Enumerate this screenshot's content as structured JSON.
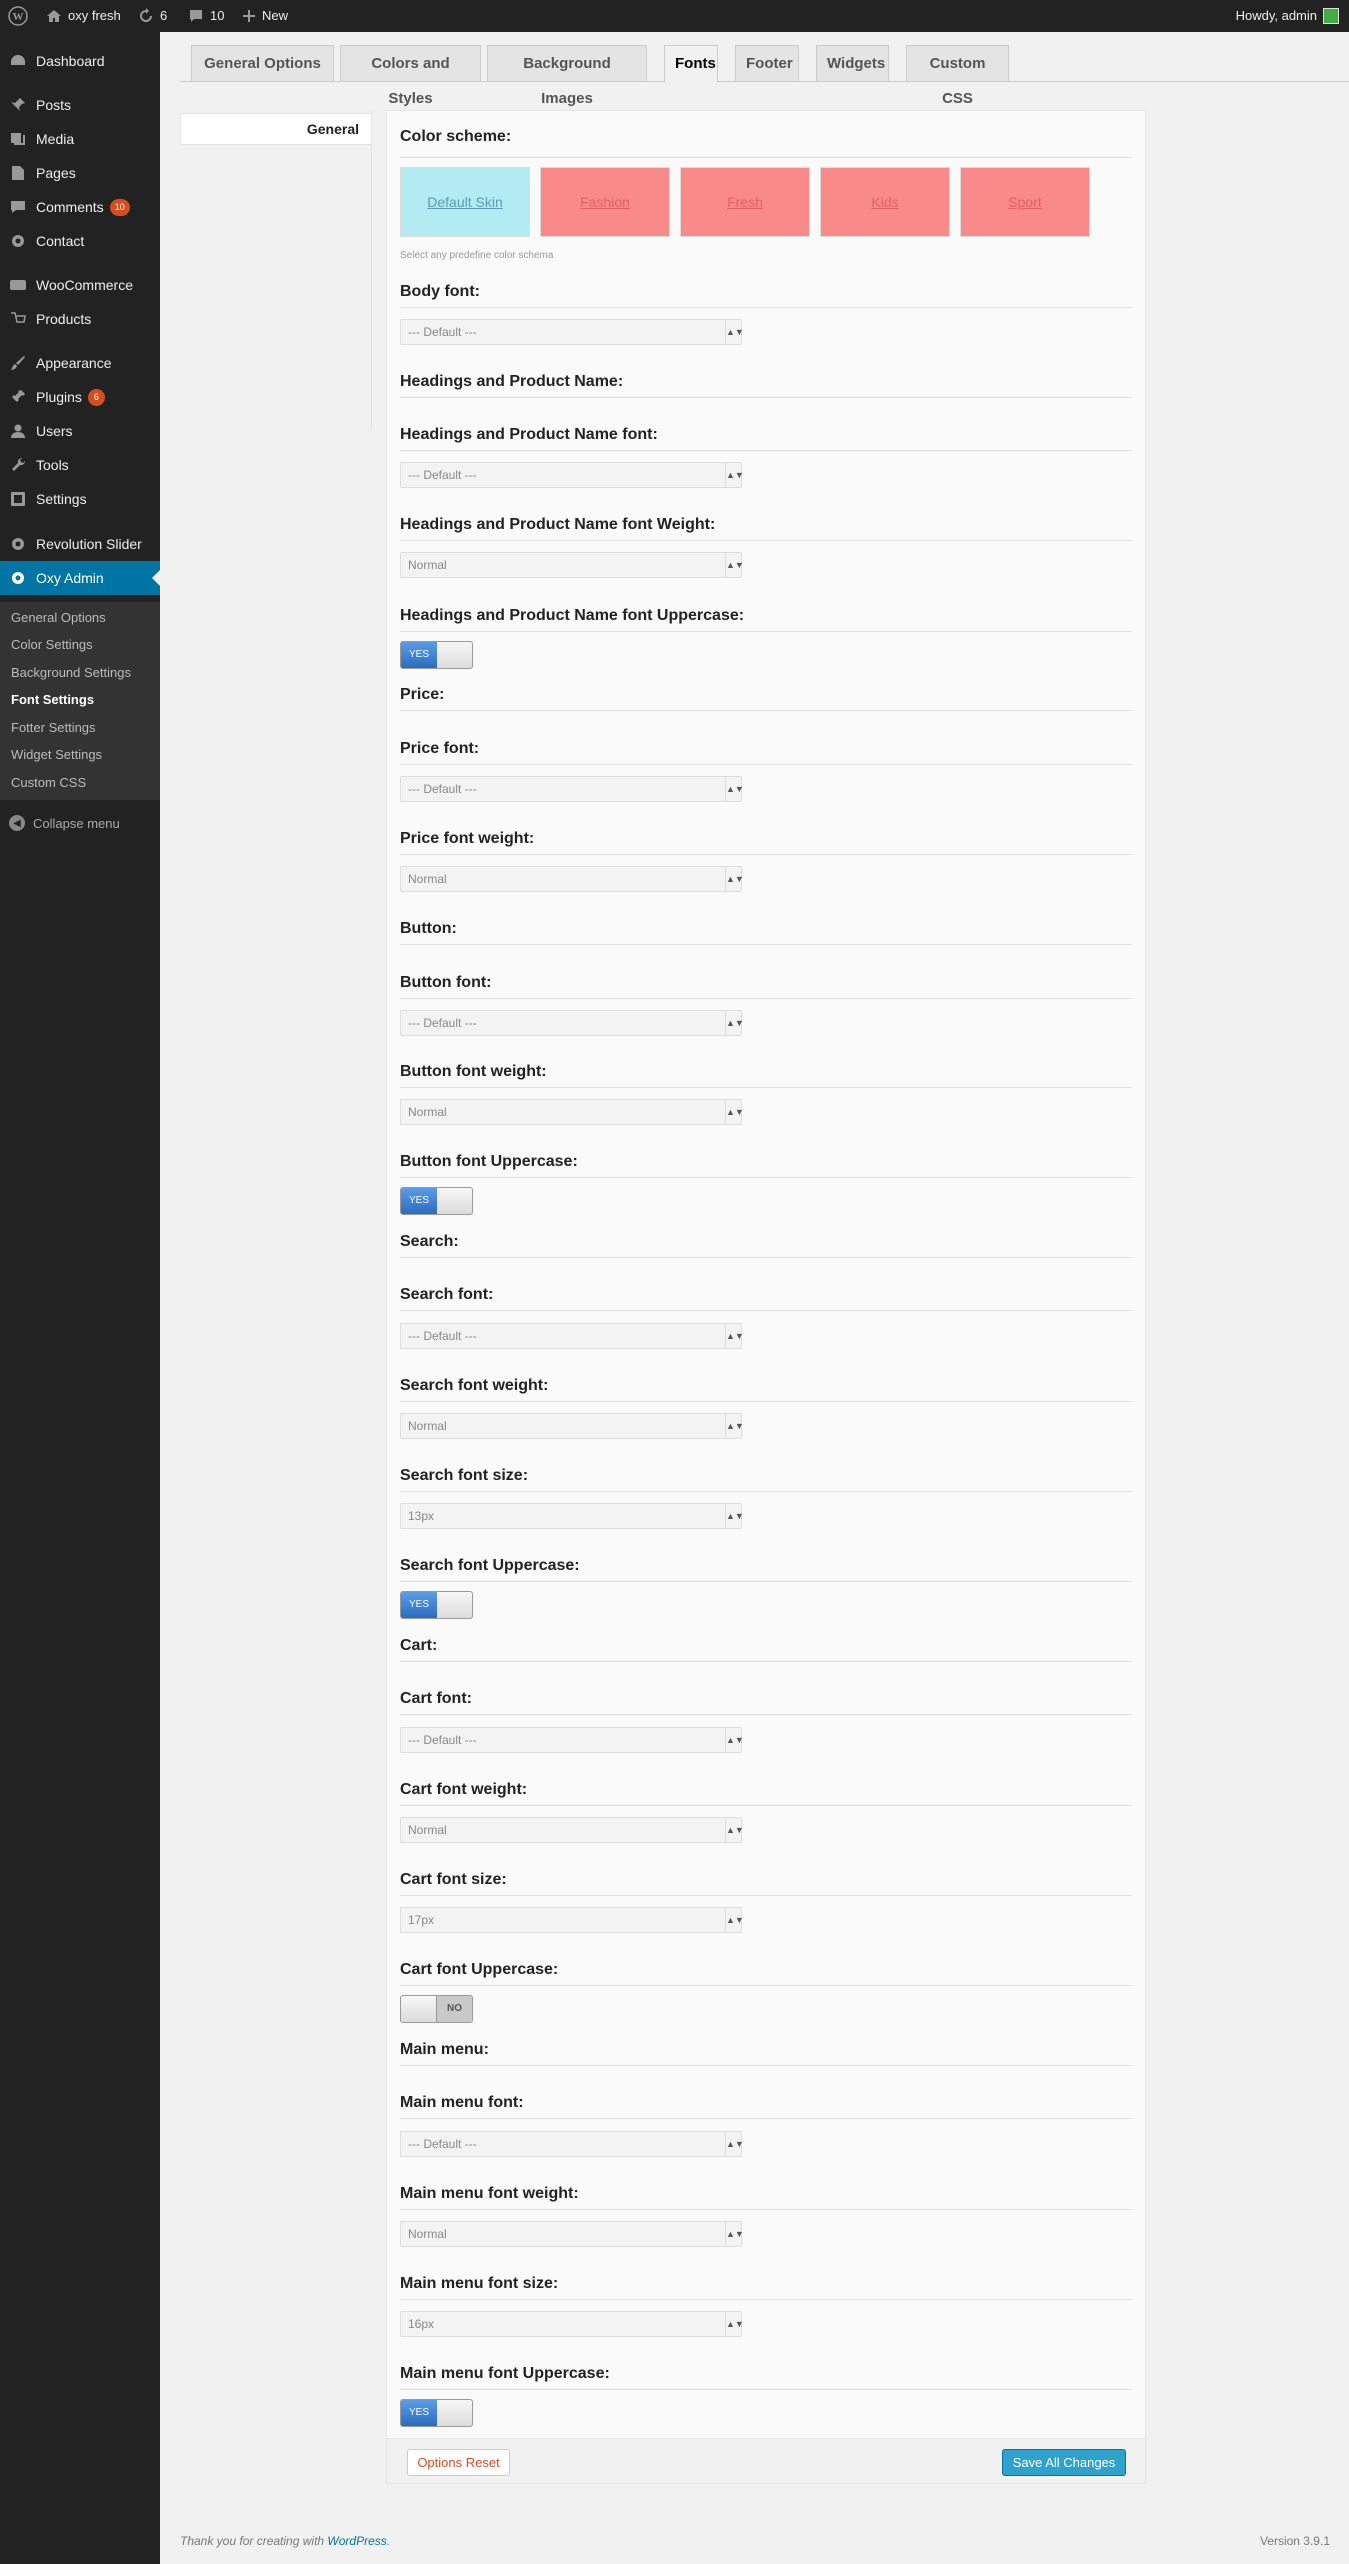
{
  "admin_bar": {
    "site_name": "oxy fresh",
    "updates_count": "6",
    "comments_count": "10",
    "new_label": "New",
    "greeting": "Howdy, admin"
  },
  "sidebar": {
    "items": [
      {
        "label": "Dashboard",
        "icon": "dashboard-icon"
      },
      {
        "label": "Posts",
        "icon": "pin-icon"
      },
      {
        "label": "Media",
        "icon": "media-icon"
      },
      {
        "label": "Pages",
        "icon": "pages-icon"
      },
      {
        "label": "Comments",
        "icon": "comments-icon",
        "badge": "10"
      },
      {
        "label": "Contact",
        "icon": "gear-icon"
      },
      {
        "label": "WooCommerce",
        "icon": "woocommerce-icon"
      },
      {
        "label": "Products",
        "icon": "products-icon"
      },
      {
        "label": "Appearance",
        "icon": "paintbrush-icon"
      },
      {
        "label": "Plugins",
        "icon": "plugin-icon",
        "badge": "6"
      },
      {
        "label": "Users",
        "icon": "users-icon"
      },
      {
        "label": "Tools",
        "icon": "wrench-icon"
      },
      {
        "label": "Settings",
        "icon": "settings-icon"
      },
      {
        "label": "Revolution Slider",
        "icon": "gear-icon"
      },
      {
        "label": "Oxy Admin",
        "icon": "gear-icon"
      }
    ],
    "submenu": [
      "General Options",
      "Color Settings",
      "Background Settings",
      "Font Settings",
      "Fotter Settings",
      "Widget Settings",
      "Custom CSS"
    ],
    "collapse_label": "Collapse menu"
  },
  "tabs": [
    "General Options",
    "Colors and Styles",
    "Background Images",
    "Fonts",
    "Footer",
    "Widgets",
    "Custom CSS"
  ],
  "left_nav": {
    "item": "General"
  },
  "color_scheme": {
    "title": "Color scheme:",
    "skins": [
      {
        "label": "Default Skin",
        "bg": "#b3ebf2",
        "fg": "#5a9bb8"
      },
      {
        "label": "Fashion",
        "bg": "#f88a8a",
        "fg": "#e86060"
      },
      {
        "label": "Fresh",
        "bg": "#f88a8a",
        "fg": "#e86060"
      },
      {
        "label": "Kids",
        "bg": "#f88a8a",
        "fg": "#e86060"
      },
      {
        "label": "Sport",
        "bg": "#f88a8a",
        "fg": "#e86060"
      }
    ],
    "hint": "Select any predefine color schema"
  },
  "body_font": {
    "title": "Body font:",
    "value": "--- Default ---"
  },
  "headings": {
    "section": "Headings and Product Name:",
    "font_title": "Headings and Product Name font:",
    "font_value": "--- Default ---",
    "weight_title": "Headings and Product Name font Weight:",
    "weight_value": "Normal",
    "upper_title": "Headings and Product Name font Uppercase:",
    "upper_value": "YES"
  },
  "price": {
    "section": "Price:",
    "font_title": "Price font:",
    "font_value": "--- Default ---",
    "weight_title": "Price font weight:",
    "weight_value": "Normal"
  },
  "button": {
    "section": "Button:",
    "font_title": "Button font:",
    "font_value": "--- Default ---",
    "weight_title": "Button font weight:",
    "weight_value": "Normal",
    "upper_title": "Button font Uppercase:",
    "upper_value": "YES"
  },
  "search": {
    "section": "Search:",
    "font_title": "Search font:",
    "font_value": "--- Default ---",
    "weight_title": "Search font weight:",
    "weight_value": "Normal",
    "size_title": "Search font size:",
    "size_value": "13px",
    "upper_title": "Search font Uppercase:",
    "upper_value": "YES"
  },
  "cart": {
    "section": "Cart:",
    "font_title": "Cart font:",
    "font_value": "--- Default ---",
    "weight_title": "Cart font weight:",
    "weight_value": "Normal",
    "size_title": "Cart font size:",
    "size_value": "17px",
    "upper_title": "Cart font Uppercase:",
    "upper_value": "NO"
  },
  "main_menu": {
    "section": "Main menu:",
    "font_title": "Main menu font:",
    "font_value": "--- Default ---",
    "weight_title": "Main menu font weight:",
    "weight_value": "Normal",
    "size_title": "Main menu font size:",
    "size_value": "16px",
    "upper_title": "Main menu font Uppercase:",
    "upper_value": "YES"
  },
  "actions": {
    "reset": "Options Reset",
    "save": "Save All Changes"
  },
  "footer": {
    "thanks": "Thank you for creating with",
    "link": "WordPress",
    "version": "Version 3.9.1"
  },
  "colors": {
    "accent": "#0074a2",
    "sidebar": "#222222",
    "save_button": "#2ea2cc"
  }
}
